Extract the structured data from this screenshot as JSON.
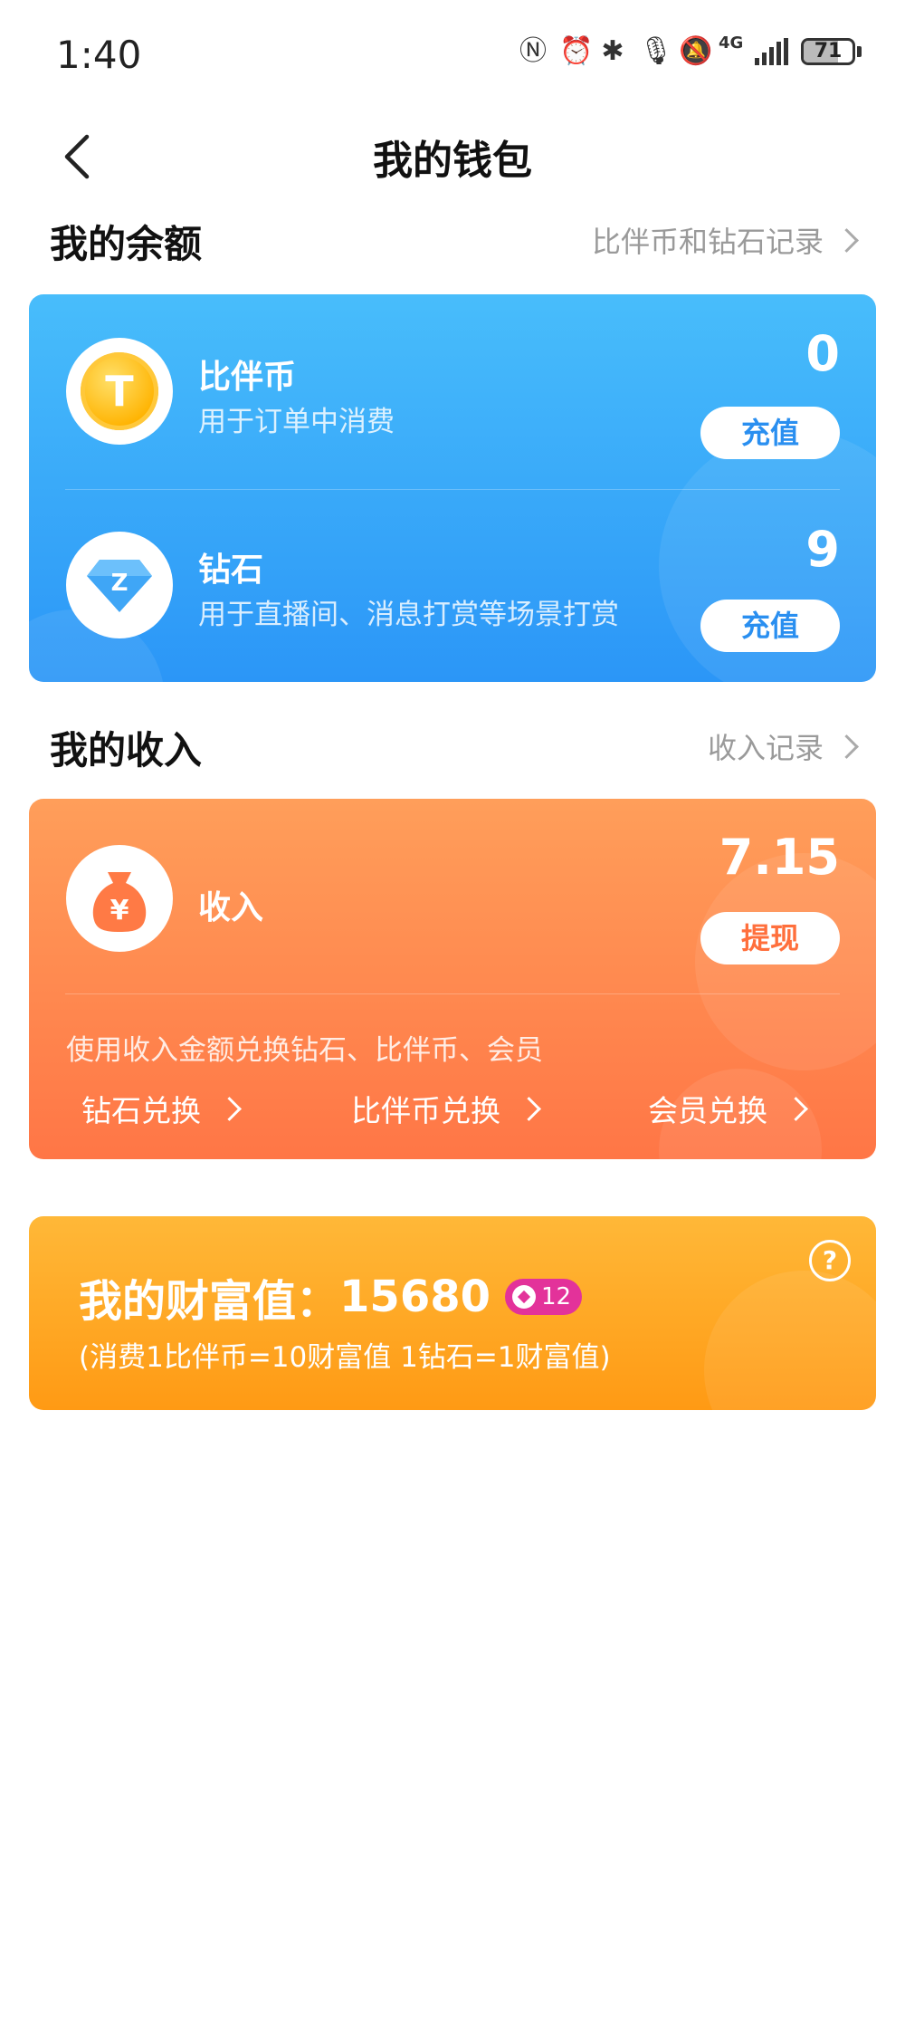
{
  "status_bar": {
    "time": "1:40",
    "net": "4G",
    "battery": "71",
    "battery_level": 0.71
  },
  "nav": {
    "title": "我的钱包"
  },
  "balance_section": {
    "title": "我的余额",
    "link": "比伴币和钻石记录",
    "coin": {
      "name": "比伴币",
      "desc": "用于订单中消费",
      "value": "0",
      "button": "充值",
      "icon_glyph": "T"
    },
    "diamond": {
      "name": "钻石",
      "desc": "用于直播间、消息打赏等场景打赏",
      "value": "9",
      "button": "充值",
      "icon_glyph": "Z"
    }
  },
  "income_section": {
    "title": "我的收入",
    "link": "收入记录",
    "name": "收入",
    "value": "7.15",
    "button": "提现",
    "icon_glyph": "¥",
    "note": "使用收入金额兑换钻石、比伴币、会员",
    "exchanges": [
      "钻石兑换",
      "比伴币兑换",
      "会员兑换"
    ]
  },
  "wealth": {
    "label": "我的财富值：",
    "value": "15680",
    "level": "12",
    "note": "(消费1比伴币=10财富值 1钻石=1财富值)",
    "help": "?"
  },
  "colors": {
    "blue_card": "#2b96f7",
    "orange_card": "#ff7646",
    "gold_card": "#ff9a14",
    "badge": "#e3329a"
  }
}
